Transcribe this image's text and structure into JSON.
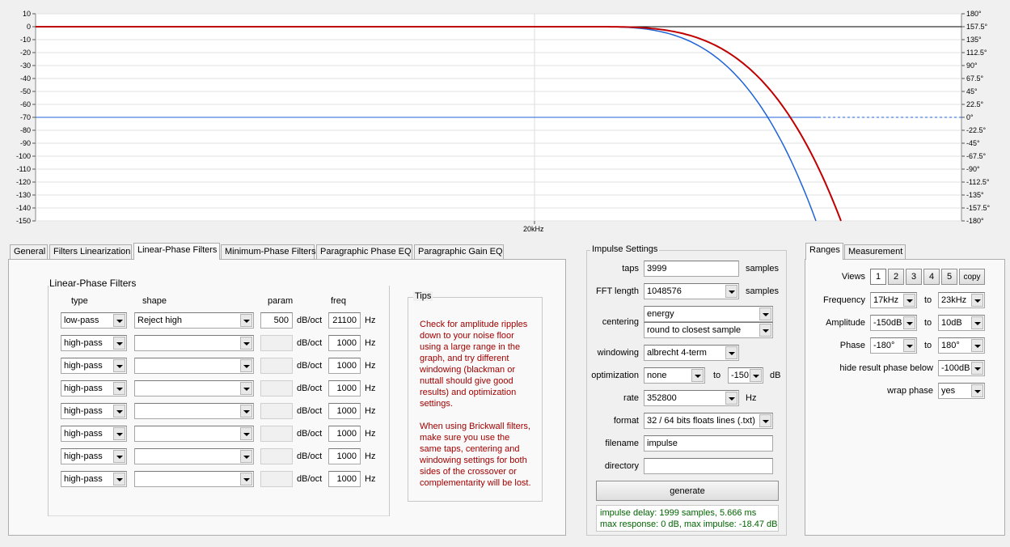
{
  "graph": {
    "y_left_labels": [
      "10",
      "0",
      "-10",
      "-20",
      "-30",
      "-40",
      "-50",
      "-60",
      "-70",
      "-80",
      "-90",
      "-100",
      "-110",
      "-120",
      "-130",
      "-140",
      "-150"
    ],
    "y_right_labels": [
      "180°",
      "157.5°",
      "135°",
      "112.5°",
      "90°",
      "67.5°",
      "45°",
      "22.5°",
      "0°",
      "-22.5°",
      "-45°",
      "-67.5°",
      "-90°",
      "-112.5°",
      "-135°",
      "-157.5°",
      "-180°"
    ],
    "x_label": "20kHz",
    "colors": {
      "magnitude_red": "#c00000",
      "magnitude_blue": "#1f63d8",
      "phase_blue": "#1f63d8"
    }
  },
  "left_tabs": [
    "General",
    "Filters Linearization",
    "Linear-Phase Filters",
    "Minimum-Phase Filters",
    "Paragraphic Phase EQ",
    "Paragraphic Gain EQ"
  ],
  "active_left_tab": "Linear-Phase Filters",
  "filters": {
    "title": "Linear-Phase Filters",
    "headers": {
      "type": "type",
      "shape": "shape",
      "param": "param",
      "freq": "freq"
    },
    "unit_param": "dB/oct",
    "unit_freq": "Hz",
    "rows": [
      {
        "type": "low-pass",
        "shape": "Reject high",
        "param": "500",
        "freq": "21100"
      },
      {
        "type": "high-pass",
        "shape": "",
        "param": "",
        "freq": "1000"
      },
      {
        "type": "high-pass",
        "shape": "",
        "param": "",
        "freq": "1000"
      },
      {
        "type": "high-pass",
        "shape": "",
        "param": "",
        "freq": "1000"
      },
      {
        "type": "high-pass",
        "shape": "",
        "param": "",
        "freq": "1000"
      },
      {
        "type": "high-pass",
        "shape": "",
        "param": "",
        "freq": "1000"
      },
      {
        "type": "high-pass",
        "shape": "",
        "param": "",
        "freq": "1000"
      },
      {
        "type": "high-pass",
        "shape": "",
        "param": "",
        "freq": "1000"
      }
    ]
  },
  "tips": {
    "title": "Tips",
    "text1": "Check for amplitude ripples\ndown to your noise floor\nusing a large range in the\ngraph, and try different\nwindowing (blackman or\nnuttall should give good\nresults) and optimization\nsettings.",
    "text2": "When using Brickwall filters,\nmake sure you use the\nsame taps, centering and\nwindowing settings for both\nsides of the crossover or\ncomplementarity will be lost."
  },
  "impulse": {
    "title": "Impulse Settings",
    "taps_label": "taps",
    "taps_value": "3999",
    "taps_unit": "samples",
    "fft_label": "FFT length",
    "fft_value": "1048576",
    "fft_unit": "samples",
    "centering_label": "centering",
    "centering_value1": "energy",
    "centering_value2": "round to closest sample",
    "windowing_label": "windowing",
    "windowing_value": "albrecht 4-term",
    "optimization_label": "optimization",
    "optimization_value": "none",
    "optimization_to": "to",
    "optimization_db": "-150",
    "optimization_unit": "dB",
    "rate_label": "rate",
    "rate_value": "352800",
    "rate_unit": "Hz",
    "format_label": "format",
    "format_value": "32 / 64 bits floats lines (.txt)",
    "filename_label": "filename",
    "filename_value": "impulse",
    "directory_label": "directory",
    "directory_value": "",
    "generate_label": "generate",
    "status_line1": "impulse delay: 1999 samples, 5.666 ms",
    "status_line2": "max response: 0 dB, max impulse: -18.47 dB"
  },
  "right_tabs": [
    "Ranges",
    "Measurement"
  ],
  "active_right_tab": "Ranges",
  "ranges": {
    "views_label": "Views",
    "views": [
      "1",
      "2",
      "3",
      "4",
      "5"
    ],
    "copy_label": "copy",
    "frequency_label": "Frequency",
    "frequency_from": "17kHz",
    "frequency_to": "23kHz",
    "amplitude_label": "Amplitude",
    "amplitude_from": "-150dB",
    "amplitude_to": "10dB",
    "phase_label": "Phase",
    "phase_from": "-180°",
    "phase_to": "180°",
    "to_label": "to",
    "hide_label": "hide result phase below",
    "hide_value": "-100dB",
    "wrap_label": "wrap phase",
    "wrap_value": "yes"
  }
}
